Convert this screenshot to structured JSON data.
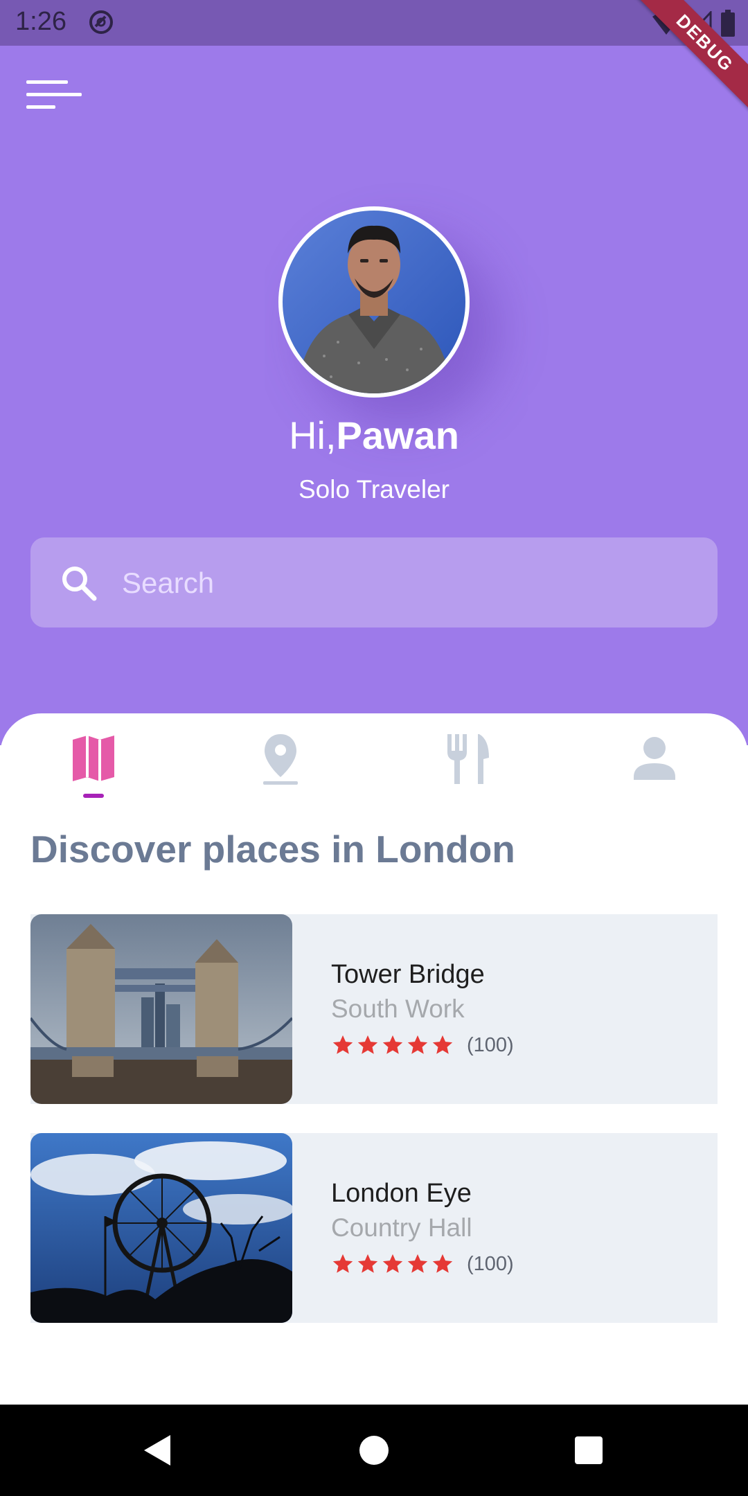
{
  "status_bar": {
    "time": "1:26"
  },
  "debug_banner": "DEBUG",
  "header": {
    "greeting_prefix": "Hi,",
    "user_name": "Pawan",
    "subtitle": "Solo Traveler",
    "search_placeholder": "Search",
    "menu_icon": "menu-icon"
  },
  "tabs": [
    {
      "icon": "map-icon",
      "active": true
    },
    {
      "icon": "location-pin-icon",
      "active": false
    },
    {
      "icon": "restaurant-icon",
      "active": false
    },
    {
      "icon": "person-icon",
      "active": false
    }
  ],
  "section": {
    "title": "Discover places in London"
  },
  "places": [
    {
      "name": "Tower Bridge",
      "location": "South Work",
      "stars": 5,
      "reviews": "(100)"
    },
    {
      "name": "London Eye",
      "location": "Country Hall",
      "stars": 5,
      "reviews": "(100)"
    }
  ],
  "colors": {
    "header_bg": "#9d7aea",
    "status_bg": "#7759b3",
    "active_tab": "#e55aa8",
    "inactive_tab": "#c8d0dc",
    "tab_indicator": "#a722b7",
    "star": "#e53935",
    "card_bg": "#ecf0f5"
  }
}
